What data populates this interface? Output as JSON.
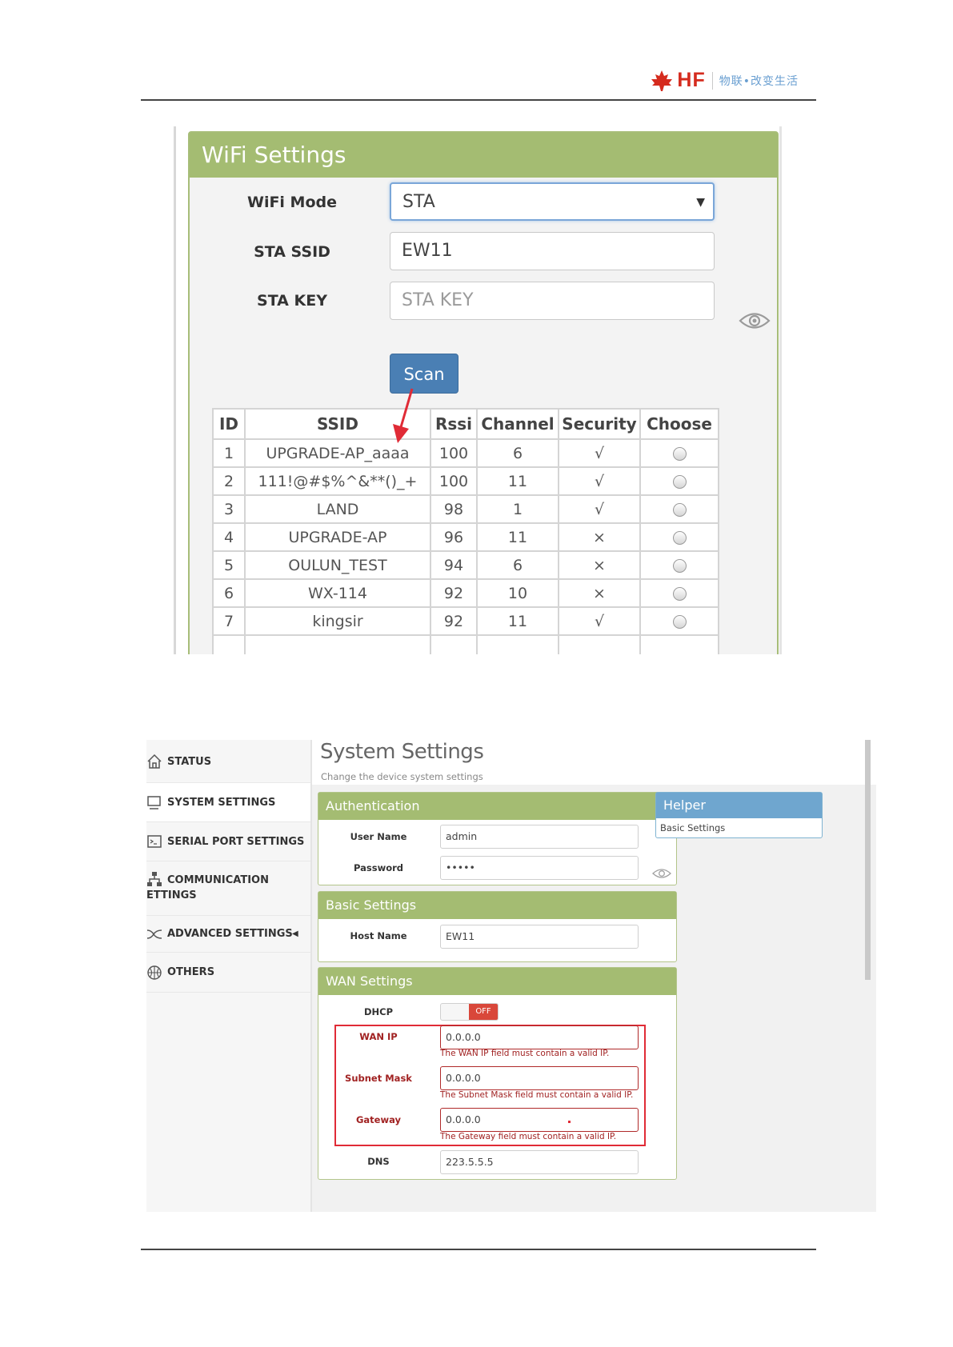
{
  "header": {
    "logo_text": "HF",
    "slogan": "物联•改变生活",
    "colors": {
      "brand_red": "#d52b1e",
      "slogan_blue": "#6a9fd1"
    }
  },
  "wifi_settings": {
    "title": "WiFi Settings",
    "wifi_mode_label": "WiFi Mode",
    "wifi_mode_value": "STA",
    "sta_ssid_label": "STA SSID",
    "sta_ssid_value": "EW11",
    "sta_key_label": "STA KEY",
    "sta_key_placeholder": "STA KEY",
    "scan_label": "Scan",
    "eye_icon": "eye-icon",
    "table": {
      "columns": [
        "ID",
        "SSID",
        "Rssi",
        "Channel",
        "Security",
        "Choose"
      ],
      "rows": [
        {
          "id": "1",
          "ssid": "UPGRADE-AP_aaaa",
          "rssi": "100",
          "channel": "6",
          "security": "√"
        },
        {
          "id": "2",
          "ssid": "111!@#$%^&**()_+",
          "rssi": "100",
          "channel": "11",
          "security": "√"
        },
        {
          "id": "3",
          "ssid": "LAND",
          "rssi": "98",
          "channel": "1",
          "security": "√"
        },
        {
          "id": "4",
          "ssid": "UPGRADE-AP",
          "rssi": "96",
          "channel": "11",
          "security": "×"
        },
        {
          "id": "5",
          "ssid": "OULUN_TEST",
          "rssi": "94",
          "channel": "6",
          "security": "×"
        },
        {
          "id": "6",
          "ssid": "WX-114",
          "rssi": "92",
          "channel": "10",
          "security": "×"
        },
        {
          "id": "7",
          "ssid": "kingsir",
          "rssi": "92",
          "channel": "11",
          "security": "√"
        }
      ]
    },
    "colors": {
      "header_green": "#a4bc72",
      "scan_blue": "#4a7fb4",
      "arrow_red": "#e02b36"
    }
  },
  "system_settings": {
    "sidebar": {
      "items": [
        {
          "label": "STATUS",
          "icon": "home-icon"
        },
        {
          "label": "SYSTEM SETTINGS",
          "icon": "monitor-icon"
        },
        {
          "label": "SERIAL PORT SETTINGS",
          "icon": "terminal-icon"
        },
        {
          "label_line1": "COMMUNICATION",
          "label_line2": "ETTINGS",
          "icon": "network-icon"
        },
        {
          "label": "ADVANCED SETTINGS",
          "icon": "shuffle-icon",
          "caret": "◀"
        },
        {
          "label": "OTHERS",
          "icon": "basketball-icon"
        }
      ]
    },
    "title": "System Settings",
    "subtitle": "Change the device system settings",
    "authentication": {
      "title": "Authentication",
      "user_name_label": "User Name",
      "user_name_value": "admin",
      "password_label": "Password",
      "password_value": "•••••"
    },
    "basic": {
      "title": "Basic Settings",
      "host_name_label": "Host Name",
      "host_name_value": "EW11"
    },
    "wan": {
      "title": "WAN Settings",
      "dhcp_label": "DHCP",
      "dhcp_state": "OFF",
      "wan_ip_label": "WAN IP",
      "wan_ip_value": "0.0.0.0",
      "wan_ip_error": "The WAN IP field must contain a valid IP.",
      "subnet_label": "Subnet Mask",
      "subnet_value": "0.0.0.0",
      "subnet_error": "The Subnet Mask field must contain a valid IP.",
      "gateway_label": "Gateway",
      "gateway_value": "0.0.0.0",
      "gateway_error": "The Gateway field must contain a valid IP.",
      "dns_label": "DNS",
      "dns_value": "223.5.5.5"
    },
    "helper": {
      "title": "Helper",
      "body": "Basic Settings"
    },
    "colors": {
      "box_green": "#a4bc72",
      "helper_blue": "#6fa6cf",
      "error_red": "#a12222",
      "toggle_off": "#d9473a"
    }
  }
}
